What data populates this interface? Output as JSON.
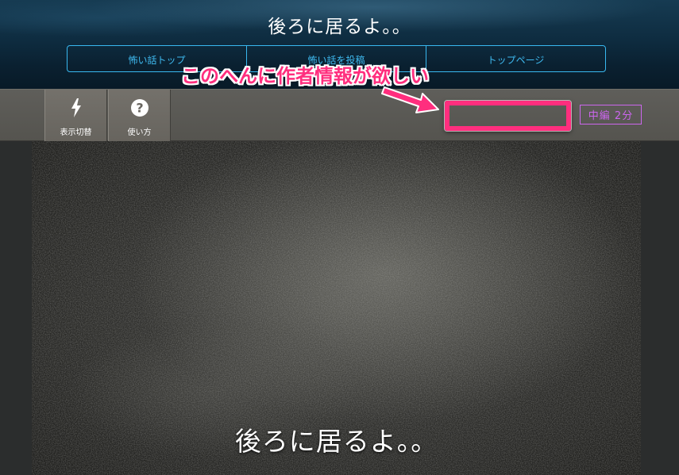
{
  "header": {
    "site_title": "後ろに居るよ。。",
    "nav": [
      {
        "label": "怖い話トップ"
      },
      {
        "label": "怖い話を投稿"
      },
      {
        "label": "トップページ"
      }
    ]
  },
  "toolbar": {
    "display_switch": {
      "label": "表示切替",
      "icon": "lightning-icon"
    },
    "usage": {
      "label": "使い方",
      "icon": "question-circle-icon"
    },
    "length_badge": "中編 2分"
  },
  "annotation": {
    "text": "このへんに作者情報が欲しい",
    "color": "#ff2e7e"
  },
  "content": {
    "story_title": "後ろに居るよ。。"
  },
  "colors": {
    "nav_accent": "#38b8f0",
    "badge_accent": "#cc66ee",
    "header_bg": "#0e2c40",
    "toolbar_bg": "#5f5e5a"
  }
}
